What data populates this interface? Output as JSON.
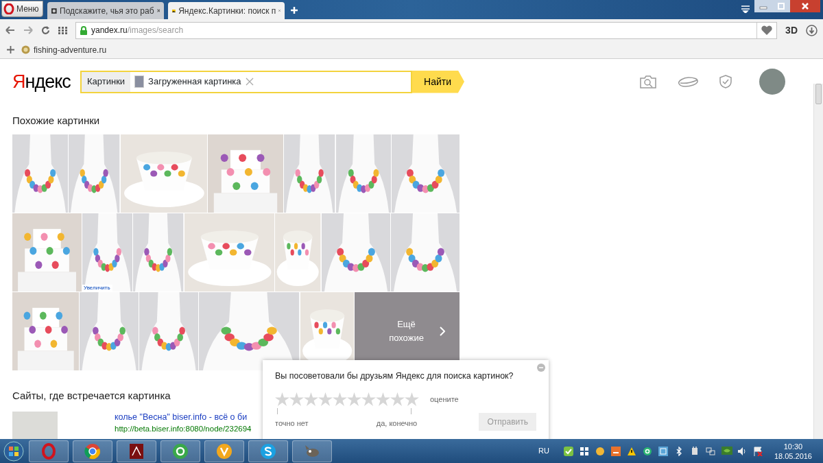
{
  "browser": {
    "menu_label": "Меню",
    "tabs": [
      {
        "title": "Подскажите, чья это раб",
        "selected": false
      },
      {
        "title": "Яндекс.Картинки: поиск п",
        "selected": true
      }
    ],
    "address": {
      "host": "yandex.ru",
      "path": "/images/search"
    },
    "toolbar_badge": "3D",
    "bookmarks": [
      {
        "label": "fishing-adventure.ru"
      }
    ]
  },
  "header": {
    "logo": "Яндекс",
    "search": {
      "scope": "Картинки",
      "chip": "Загруженная картинка",
      "button": "Найти"
    }
  },
  "similar": {
    "title": "Похожие картинки",
    "rows": [
      [
        {
          "kind": "necklace"
        },
        {
          "kind": "necklace"
        },
        {
          "kind": "cup"
        },
        {
          "kind": "cake"
        },
        {
          "kind": "necklace"
        },
        {
          "kind": "necklace"
        },
        {
          "kind": "necklace"
        }
      ],
      [
        {
          "kind": "cake"
        },
        {
          "kind": "necklace",
          "zoom_link": "Увеличить"
        },
        {
          "kind": "necklace"
        },
        {
          "kind": "cup"
        },
        {
          "kind": "cup"
        },
        {
          "kind": "necklace"
        },
        {
          "kind": "necklace"
        }
      ],
      [
        {
          "kind": "cake"
        },
        {
          "kind": "necklace"
        },
        {
          "kind": "necklace"
        },
        {
          "kind": "necklace"
        },
        {
          "kind": "cup"
        }
      ]
    ],
    "more_button": "Ещё похожие"
  },
  "sites": {
    "title": "Сайты, где встречается картинка",
    "results": [
      {
        "title": "колье \"Весна\" biser.info - всё о би",
        "url": "http://beta.biser.info:8080/node/232694"
      }
    ]
  },
  "survey": {
    "question": "Вы посоветовали бы друзьям Яндекс для поиска картинок?",
    "stars": 0,
    "hint": "оцените",
    "low_label": "точно нет",
    "high_label": "да, конечно",
    "submit": {
      "label": "Отправить",
      "disabled": true
    }
  },
  "taskbar": {
    "apps": [
      {
        "kind": "ring"
      },
      {
        "kind": "wheel"
      },
      {
        "kind": "document"
      },
      {
        "kind": "green-circle"
      },
      {
        "kind": "yellow-circle"
      },
      {
        "kind": "blue-circle"
      },
      {
        "kind": "animal"
      }
    ],
    "language": "RU",
    "time": "10:30",
    "date": "18.05.2016"
  }
}
